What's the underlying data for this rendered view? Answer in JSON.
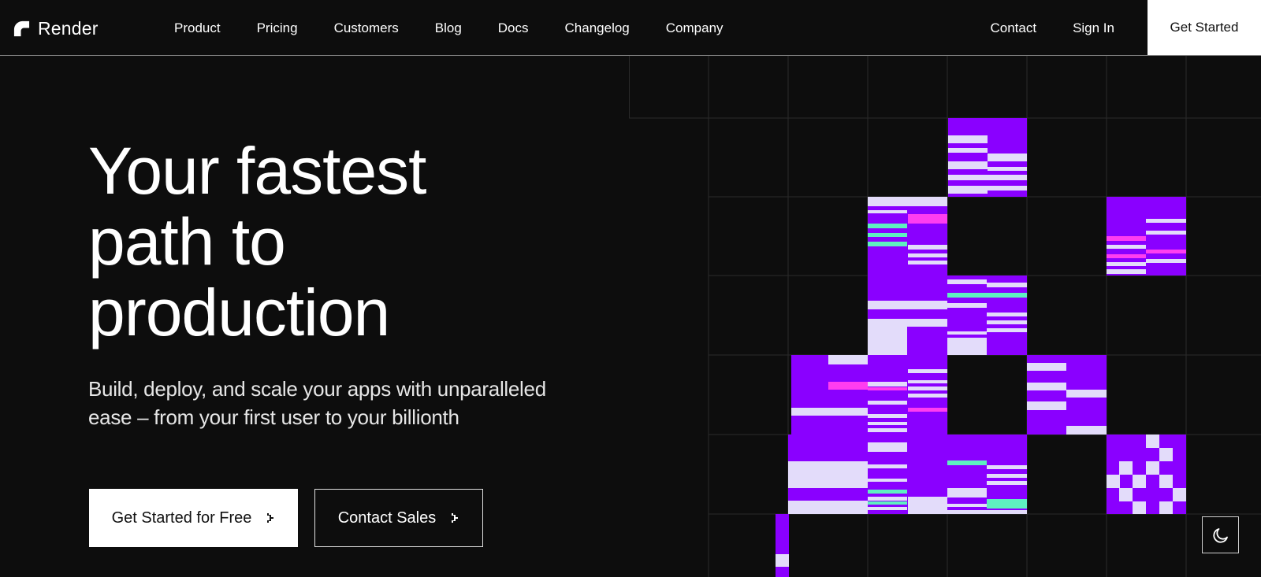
{
  "nav": {
    "logo_text": "Render",
    "links": [
      "Product",
      "Pricing",
      "Customers",
      "Blog",
      "Docs",
      "Changelog",
      "Company"
    ],
    "contact": "Contact",
    "sign_in": "Sign In",
    "get_started": "Get Started"
  },
  "hero": {
    "title_lines": [
      "Your fastest",
      "path to",
      "production"
    ],
    "subtitle_lines": [
      "Build, deploy, and scale your apps with unparalleled",
      "ease – from your first user to your billionth"
    ],
    "primary_cta": "Get Started for Free",
    "secondary_cta": "Contact Sales"
  },
  "icons": {
    "logo": "render-logo-icon",
    "cta_arrow": "chevron-right-icon",
    "theme_toggle": "moon-icon"
  },
  "colors": {
    "background": "#0d0d0d",
    "accent_purple": "#8a00ff",
    "light_lavender": "#e3dcfa",
    "magenta": "#ff3df0",
    "mint": "#5ef0c0",
    "grid_line": "#2a2a2a"
  }
}
